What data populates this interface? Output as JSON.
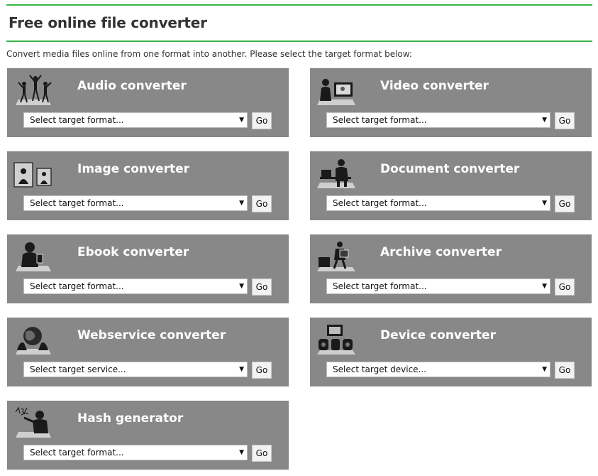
{
  "page": {
    "title": "Free online file converter",
    "intro": "Convert media files online from one format into another. Please select the target format below:"
  },
  "colors": {
    "accent_rule": "#3cb44a",
    "panel_bg": "#888888",
    "panel_text": "#ffffff"
  },
  "converters": [
    {
      "name": "Audio converter",
      "select_placeholder": "Select target format...",
      "go_label": "Go",
      "icon": "dancers-icon"
    },
    {
      "name": "Video converter",
      "select_placeholder": "Select target format...",
      "go_label": "Go",
      "icon": "video-viewer-icon"
    },
    {
      "name": "Image converter",
      "select_placeholder": "Select target format...",
      "go_label": "Go",
      "icon": "picture-frame-icon"
    },
    {
      "name": "Document converter",
      "select_placeholder": "Select target format...",
      "go_label": "Go",
      "icon": "desk-worker-icon"
    },
    {
      "name": "Ebook converter",
      "select_placeholder": "Select target format...",
      "go_label": "Go",
      "icon": "reader-icon"
    },
    {
      "name": "Archive converter",
      "select_placeholder": "Select target format...",
      "go_label": "Go",
      "icon": "box-carrier-icon"
    },
    {
      "name": "Webservice converter",
      "select_placeholder": "Select target service...",
      "go_label": "Go",
      "icon": "globe-hands-icon"
    },
    {
      "name": "Device converter",
      "select_placeholder": "Select target device...",
      "go_label": "Go",
      "icon": "devices-icon"
    },
    {
      "name": "Hash generator",
      "select_placeholder": "Select target format...",
      "go_label": "Go",
      "icon": "chalkboard-writer-icon"
    }
  ]
}
